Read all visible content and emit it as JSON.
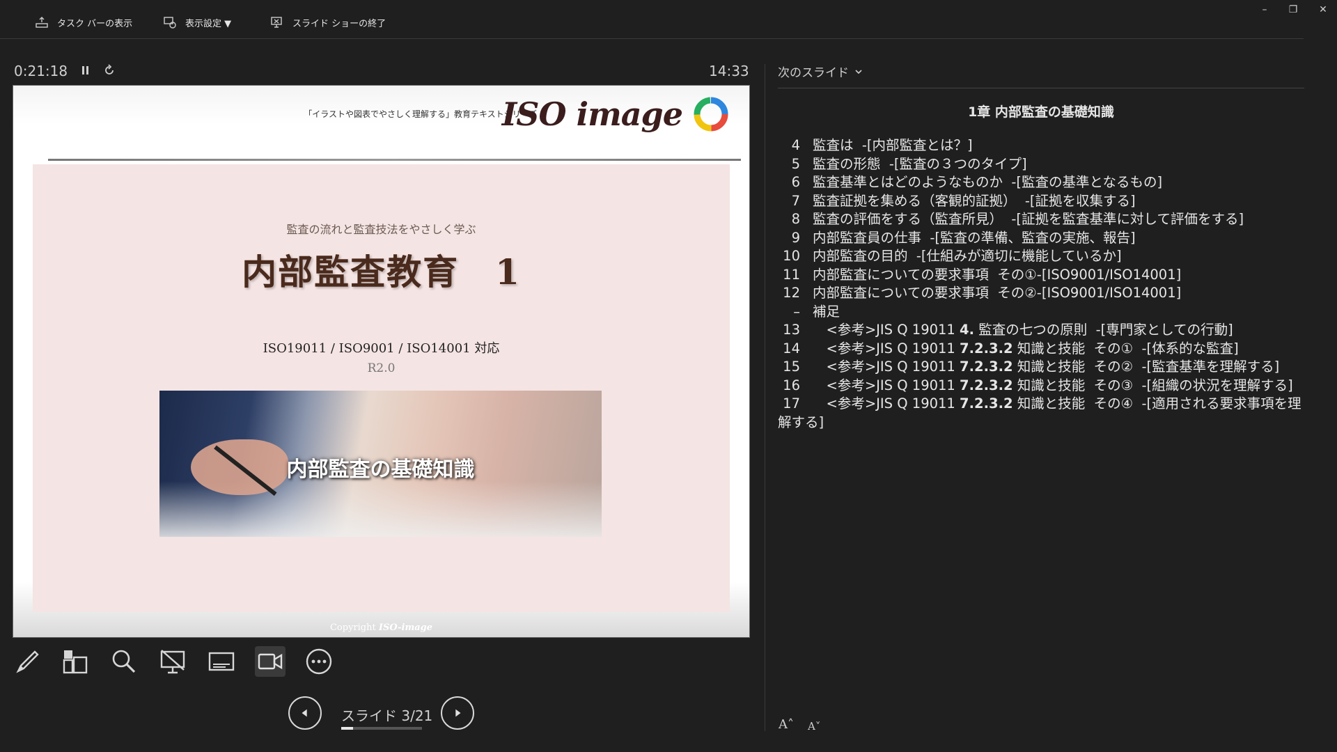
{
  "toolbar": {
    "taskbar_label": "タスク バーの表示",
    "display_settings_label": "表示設定 ▼",
    "end_show_label": "スライド ショーの終了"
  },
  "window": {
    "minimize": "–",
    "restore": "❐",
    "close": "✕"
  },
  "timer": {
    "elapsed": "0:21:18",
    "clock": "14:33"
  },
  "slide": {
    "series_label": "「イラストや図表でやさしく理解する」教育テキストシリーズ",
    "logo_text": "ISO image",
    "subtitle": "監査の流れと監査技法をやさしく学ぶ",
    "title": "内部監査教育　1",
    "standards": "ISO19011 / ISO9001 / ISO14001 対応",
    "version": "R2.0",
    "photo_caption": "内部監査の基礎知識",
    "copyright_prefix": "Copyright",
    "copyright_logo": "ISO-image"
  },
  "navigation": {
    "slide_counter": "スライド 3/21",
    "current": 3,
    "total": 21
  },
  "notes": {
    "next_slide_label": "次のスライド",
    "chapter_title": "1章 内部監査の基礎知識",
    "items": [
      {
        "num": "4",
        "pre": "監査は  -[内部監査とは？]",
        "bold": "",
        "post": ""
      },
      {
        "num": "5",
        "pre": "監査の形態  -[監査の３つのタイプ]",
        "bold": "",
        "post": ""
      },
      {
        "num": "6",
        "pre": "監査基準とはどのようなものか  -[監査の基準となるもの]",
        "bold": "",
        "post": ""
      },
      {
        "num": "7",
        "pre": "監査証拠を集める（客観的証拠）  -[証拠を収集する]",
        "bold": "",
        "post": ""
      },
      {
        "num": "8",
        "pre": "監査の評価をする（監査所見）  -[証拠を監査基準に対して評価をする]",
        "bold": "",
        "post": ""
      },
      {
        "num": "9",
        "pre": "内部監査員の仕事  -[監査の準備、監査の実施、報告]",
        "bold": "",
        "post": ""
      },
      {
        "num": "10",
        "pre": "内部監査の目的  -[仕組みが適切に機能しているか]",
        "bold": "",
        "post": ""
      },
      {
        "num": "11",
        "pre": "内部監査についての要求事項  その①-[ISO9001/ISO14001]",
        "bold": "",
        "post": ""
      },
      {
        "num": "12",
        "pre": "内部監査についての要求事項  その②-[ISO9001/ISO14001]",
        "bold": "",
        "post": ""
      },
      {
        "num": "–",
        "pre": "補足",
        "bold": "",
        "post": ""
      },
      {
        "num": "13",
        "pre": "　<参考>JIS Q 19011 ",
        "bold": "4.",
        "post": " 監査の七つの原則  -[専門家としての行動]"
      },
      {
        "num": "14",
        "pre": "　<参考>JIS Q 19011 ",
        "bold": "7.2.3.2",
        "post": " 知識と技能  その①  -[体系的な監査]"
      },
      {
        "num": "15",
        "pre": "　<参考>JIS Q 19011 ",
        "bold": "7.2.3.2",
        "post": " 知識と技能  その②  -[監査基準を理解する]"
      },
      {
        "num": "16",
        "pre": "　<参考>JIS Q 19011 ",
        "bold": "7.2.3.2",
        "post": " 知識と技能  その③  -[組織の状況を理解する]"
      },
      {
        "num": "17",
        "pre": "　<参考>JIS Q 19011 ",
        "bold": "7.2.3.2",
        "post": " 知識と技能  その④  -[適用される要求事項を理解する]"
      }
    ],
    "font_increase": "A˄",
    "font_decrease": "A˅"
  },
  "colors": {
    "background": "#1f1f1f",
    "slide_body": "#f4e4e3",
    "title_brown": "#4a2a1c"
  }
}
